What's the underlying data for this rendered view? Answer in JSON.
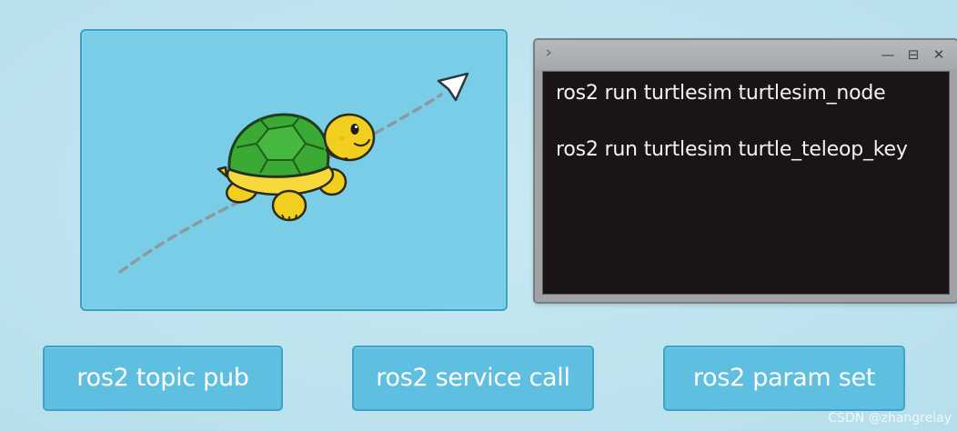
{
  "terminal": {
    "lines": [
      "ros2 run turtlesim turtlesim_node",
      "ros2 run turtlesim turtle_teleop_key"
    ],
    "controls": {
      "minimize": "—",
      "maximize": "⊟",
      "close": "✕"
    }
  },
  "buttons": {
    "topic": "ros2 topic pub",
    "service": "ros2 service call",
    "param": "ros2 param set"
  },
  "watermark": "CSDN @zhangrelay",
  "colors": {
    "canvas": "#79cde6",
    "button": "#5ebfe0",
    "terminal_bg": "#1a1414",
    "turtle_shell": "#3aaa35",
    "turtle_body": "#f2cf1f"
  },
  "icons": {
    "turtle": "turtle-icon",
    "path_arrow": "dashed-arrow-icon"
  }
}
